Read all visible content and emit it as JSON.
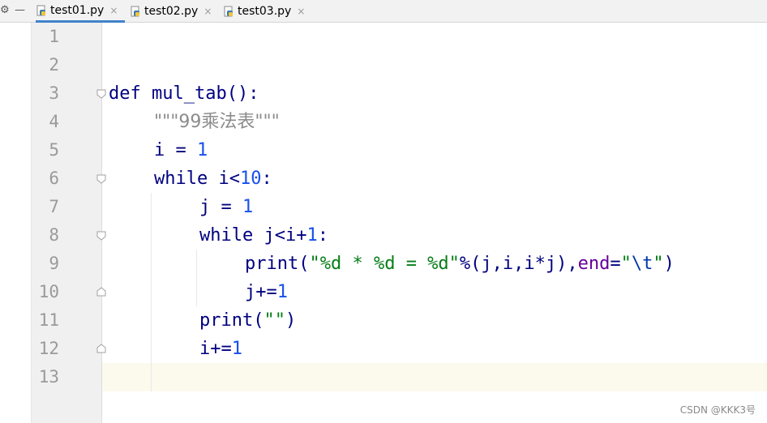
{
  "tabs": [
    {
      "label": "test01.py",
      "active": true
    },
    {
      "label": "test02.py",
      "active": false
    },
    {
      "label": "test03.py",
      "active": false
    }
  ],
  "tab_close_glyph": "×",
  "toolbar": {
    "settings_glyph": "⚙",
    "minimize_glyph": "—"
  },
  "line_numbers": [
    "1",
    "2",
    "3",
    "4",
    "5",
    "6",
    "7",
    "8",
    "9",
    "10",
    "11",
    "12",
    "13"
  ],
  "code": {
    "l3_def": "def",
    "l3_name": "mul_tab",
    "l3_rest": "():",
    "l4_docstring": "\"\"\"99乘法表\"\"\"",
    "l5_var": "i = ",
    "l5_num": "1",
    "l6_kw": "while",
    "l6_cond": " i<",
    "l6_num": "10",
    "l6_colon": ":",
    "l7_var": "j = ",
    "l7_num": "1",
    "l8_kw": "while",
    "l8_cond": " j<i+",
    "l8_num": "1",
    "l8_colon": ":",
    "l9_print": "print",
    "l9_paren": "(",
    "l9_fmt": "\"%d * %d = %d\"",
    "l9_args": "%(j,i,i*j),",
    "l9_kwarg": "end",
    "l9_eq": "=",
    "l9_q1": "\"",
    "l9_esc": "\\t",
    "l9_q2": "\"",
    "l9_close": ")",
    "l10_var": "j+=",
    "l10_num": "1",
    "l11_print": "print",
    "l11_paren": "(",
    "l11_str": "\"\"",
    "l11_close": ")",
    "l12_var": "i+=",
    "l12_num": "1"
  },
  "watermark": "CSDN @KKK3号",
  "colors": {
    "keyword": "#000080",
    "number": "#1750eb",
    "string": "#067d17",
    "docstring": "#8c8c8c",
    "kwarg": "#660099",
    "current_line": "#fcfaed",
    "tab_underline": "#4083c9"
  },
  "icons": [
    "settings-icon",
    "minimize-icon",
    "python-file-icon",
    "close-icon",
    "fold-icon"
  ]
}
